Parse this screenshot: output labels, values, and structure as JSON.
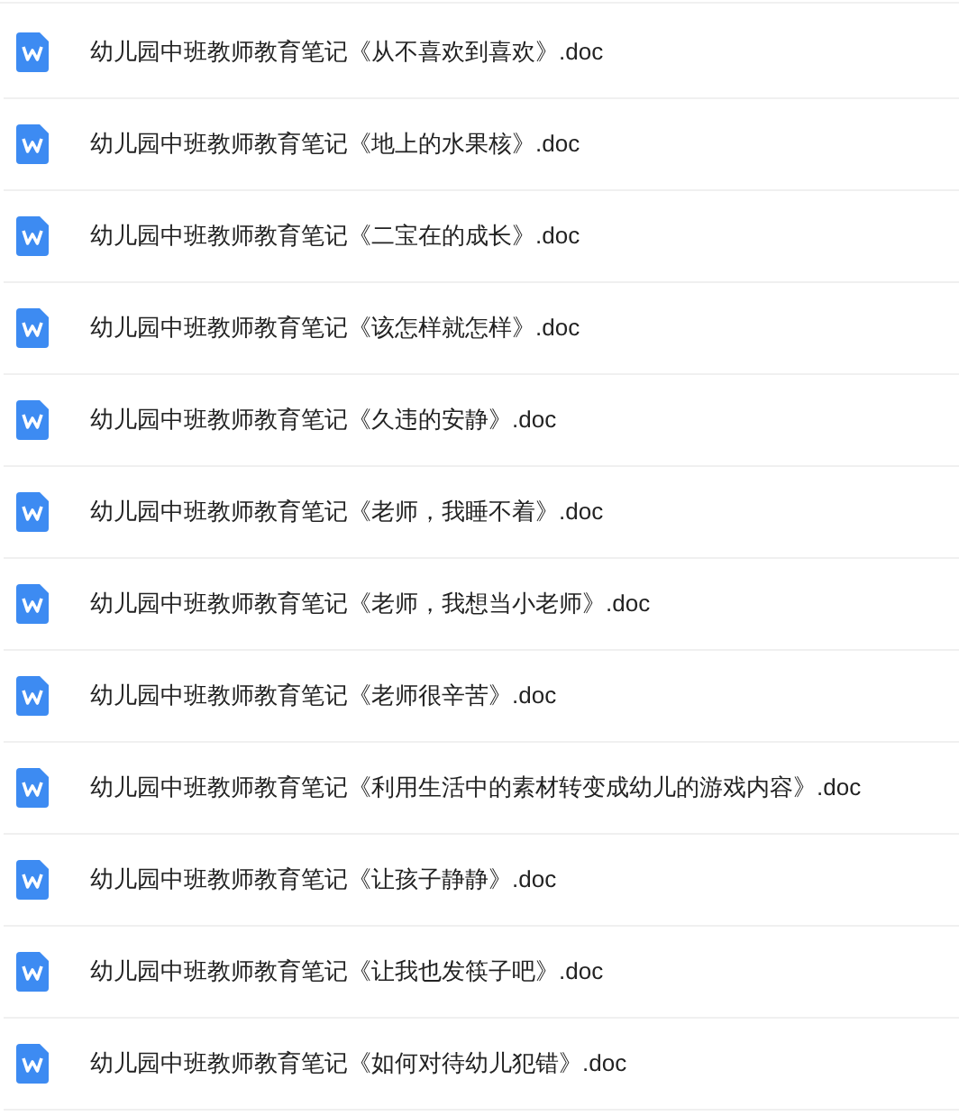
{
  "files": [
    {
      "name": "幼儿园中班教师教育笔记《从不喜欢到喜欢》.doc"
    },
    {
      "name": "幼儿园中班教师教育笔记《地上的水果核》.doc"
    },
    {
      "name": "幼儿园中班教师教育笔记《二宝在的成长》.doc"
    },
    {
      "name": "幼儿园中班教师教育笔记《该怎样就怎样》.doc"
    },
    {
      "name": "幼儿园中班教师教育笔记《久违的安静》.doc"
    },
    {
      "name": "幼儿园中班教师教育笔记《老师，我睡不着》.doc"
    },
    {
      "name": "幼儿园中班教师教育笔记《老师，我想当小老师》.doc"
    },
    {
      "name": "幼儿园中班教师教育笔记《老师很辛苦》.doc"
    },
    {
      "name": "幼儿园中班教师教育笔记《利用生活中的素材转变成幼儿的游戏内容》.doc"
    },
    {
      "name": "幼儿园中班教师教育笔记《让孩子静静》.doc"
    },
    {
      "name": "幼儿园中班教师教育笔记《让我也发筷子吧》.doc"
    },
    {
      "name": "幼儿园中班教师教育笔记《如何对待幼儿犯错》.doc"
    }
  ]
}
